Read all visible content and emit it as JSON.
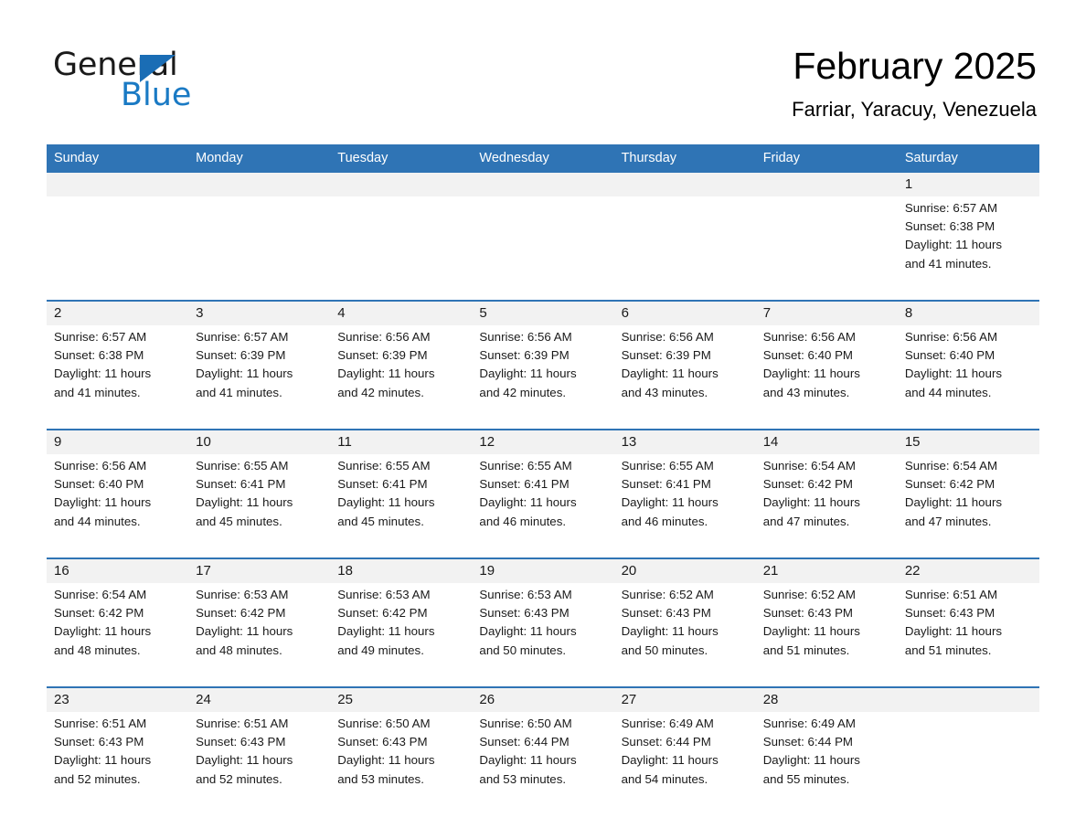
{
  "brand": {
    "name_part1": "General",
    "name_part2": "Blue",
    "triangle_color": "#1a6db5",
    "blue_color": "#1a7ac4"
  },
  "header": {
    "title": "February 2025",
    "subtitle": "Farriar, Yaracuy, Venezuela",
    "accent_color": "#2f74b5",
    "daynum_band_color": "#f2f2f2"
  },
  "weekday_headers": [
    "Sunday",
    "Monday",
    "Tuesday",
    "Wednesday",
    "Thursday",
    "Friday",
    "Saturday"
  ],
  "labels": {
    "sunrise_prefix": "Sunrise:",
    "sunset_prefix": "Sunset:",
    "daylight_prefix": "Daylight:"
  },
  "weeks": [
    [
      {
        "day": "",
        "sunrise": "",
        "sunset": "",
        "daylight_line1": "",
        "daylight_line2": ""
      },
      {
        "day": "",
        "sunrise": "",
        "sunset": "",
        "daylight_line1": "",
        "daylight_line2": ""
      },
      {
        "day": "",
        "sunrise": "",
        "sunset": "",
        "daylight_line1": "",
        "daylight_line2": ""
      },
      {
        "day": "",
        "sunrise": "",
        "sunset": "",
        "daylight_line1": "",
        "daylight_line2": ""
      },
      {
        "day": "",
        "sunrise": "",
        "sunset": "",
        "daylight_line1": "",
        "daylight_line2": ""
      },
      {
        "day": "",
        "sunrise": "",
        "sunset": "",
        "daylight_line1": "",
        "daylight_line2": ""
      },
      {
        "day": "1",
        "sunrise": "Sunrise: 6:57 AM",
        "sunset": "Sunset: 6:38 PM",
        "daylight_line1": "Daylight: 11 hours",
        "daylight_line2": "and 41 minutes."
      }
    ],
    [
      {
        "day": "2",
        "sunrise": "Sunrise: 6:57 AM",
        "sunset": "Sunset: 6:38 PM",
        "daylight_line1": "Daylight: 11 hours",
        "daylight_line2": "and 41 minutes."
      },
      {
        "day": "3",
        "sunrise": "Sunrise: 6:57 AM",
        "sunset": "Sunset: 6:39 PM",
        "daylight_line1": "Daylight: 11 hours",
        "daylight_line2": "and 41 minutes."
      },
      {
        "day": "4",
        "sunrise": "Sunrise: 6:56 AM",
        "sunset": "Sunset: 6:39 PM",
        "daylight_line1": "Daylight: 11 hours",
        "daylight_line2": "and 42 minutes."
      },
      {
        "day": "5",
        "sunrise": "Sunrise: 6:56 AM",
        "sunset": "Sunset: 6:39 PM",
        "daylight_line1": "Daylight: 11 hours",
        "daylight_line2": "and 42 minutes."
      },
      {
        "day": "6",
        "sunrise": "Sunrise: 6:56 AM",
        "sunset": "Sunset: 6:39 PM",
        "daylight_line1": "Daylight: 11 hours",
        "daylight_line2": "and 43 minutes."
      },
      {
        "day": "7",
        "sunrise": "Sunrise: 6:56 AM",
        "sunset": "Sunset: 6:40 PM",
        "daylight_line1": "Daylight: 11 hours",
        "daylight_line2": "and 43 minutes."
      },
      {
        "day": "8",
        "sunrise": "Sunrise: 6:56 AM",
        "sunset": "Sunset: 6:40 PM",
        "daylight_line1": "Daylight: 11 hours",
        "daylight_line2": "and 44 minutes."
      }
    ],
    [
      {
        "day": "9",
        "sunrise": "Sunrise: 6:56 AM",
        "sunset": "Sunset: 6:40 PM",
        "daylight_line1": "Daylight: 11 hours",
        "daylight_line2": "and 44 minutes."
      },
      {
        "day": "10",
        "sunrise": "Sunrise: 6:55 AM",
        "sunset": "Sunset: 6:41 PM",
        "daylight_line1": "Daylight: 11 hours",
        "daylight_line2": "and 45 minutes."
      },
      {
        "day": "11",
        "sunrise": "Sunrise: 6:55 AM",
        "sunset": "Sunset: 6:41 PM",
        "daylight_line1": "Daylight: 11 hours",
        "daylight_line2": "and 45 minutes."
      },
      {
        "day": "12",
        "sunrise": "Sunrise: 6:55 AM",
        "sunset": "Sunset: 6:41 PM",
        "daylight_line1": "Daylight: 11 hours",
        "daylight_line2": "and 46 minutes."
      },
      {
        "day": "13",
        "sunrise": "Sunrise: 6:55 AM",
        "sunset": "Sunset: 6:41 PM",
        "daylight_line1": "Daylight: 11 hours",
        "daylight_line2": "and 46 minutes."
      },
      {
        "day": "14",
        "sunrise": "Sunrise: 6:54 AM",
        "sunset": "Sunset: 6:42 PM",
        "daylight_line1": "Daylight: 11 hours",
        "daylight_line2": "and 47 minutes."
      },
      {
        "day": "15",
        "sunrise": "Sunrise: 6:54 AM",
        "sunset": "Sunset: 6:42 PM",
        "daylight_line1": "Daylight: 11 hours",
        "daylight_line2": "and 47 minutes."
      }
    ],
    [
      {
        "day": "16",
        "sunrise": "Sunrise: 6:54 AM",
        "sunset": "Sunset: 6:42 PM",
        "daylight_line1": "Daylight: 11 hours",
        "daylight_line2": "and 48 minutes."
      },
      {
        "day": "17",
        "sunrise": "Sunrise: 6:53 AM",
        "sunset": "Sunset: 6:42 PM",
        "daylight_line1": "Daylight: 11 hours",
        "daylight_line2": "and 48 minutes."
      },
      {
        "day": "18",
        "sunrise": "Sunrise: 6:53 AM",
        "sunset": "Sunset: 6:42 PM",
        "daylight_line1": "Daylight: 11 hours",
        "daylight_line2": "and 49 minutes."
      },
      {
        "day": "19",
        "sunrise": "Sunrise: 6:53 AM",
        "sunset": "Sunset: 6:43 PM",
        "daylight_line1": "Daylight: 11 hours",
        "daylight_line2": "and 50 minutes."
      },
      {
        "day": "20",
        "sunrise": "Sunrise: 6:52 AM",
        "sunset": "Sunset: 6:43 PM",
        "daylight_line1": "Daylight: 11 hours",
        "daylight_line2": "and 50 minutes."
      },
      {
        "day": "21",
        "sunrise": "Sunrise: 6:52 AM",
        "sunset": "Sunset: 6:43 PM",
        "daylight_line1": "Daylight: 11 hours",
        "daylight_line2": "and 51 minutes."
      },
      {
        "day": "22",
        "sunrise": "Sunrise: 6:51 AM",
        "sunset": "Sunset: 6:43 PM",
        "daylight_line1": "Daylight: 11 hours",
        "daylight_line2": "and 51 minutes."
      }
    ],
    [
      {
        "day": "23",
        "sunrise": "Sunrise: 6:51 AM",
        "sunset": "Sunset: 6:43 PM",
        "daylight_line1": "Daylight: 11 hours",
        "daylight_line2": "and 52 minutes."
      },
      {
        "day": "24",
        "sunrise": "Sunrise: 6:51 AM",
        "sunset": "Sunset: 6:43 PM",
        "daylight_line1": "Daylight: 11 hours",
        "daylight_line2": "and 52 minutes."
      },
      {
        "day": "25",
        "sunrise": "Sunrise: 6:50 AM",
        "sunset": "Sunset: 6:43 PM",
        "daylight_line1": "Daylight: 11 hours",
        "daylight_line2": "and 53 minutes."
      },
      {
        "day": "26",
        "sunrise": "Sunrise: 6:50 AM",
        "sunset": "Sunset: 6:44 PM",
        "daylight_line1": "Daylight: 11 hours",
        "daylight_line2": "and 53 minutes."
      },
      {
        "day": "27",
        "sunrise": "Sunrise: 6:49 AM",
        "sunset": "Sunset: 6:44 PM",
        "daylight_line1": "Daylight: 11 hours",
        "daylight_line2": "and 54 minutes."
      },
      {
        "day": "28",
        "sunrise": "Sunrise: 6:49 AM",
        "sunset": "Sunset: 6:44 PM",
        "daylight_line1": "Daylight: 11 hours",
        "daylight_line2": "and 55 minutes."
      },
      {
        "day": "",
        "sunrise": "",
        "sunset": "",
        "daylight_line1": "",
        "daylight_line2": ""
      }
    ]
  ]
}
